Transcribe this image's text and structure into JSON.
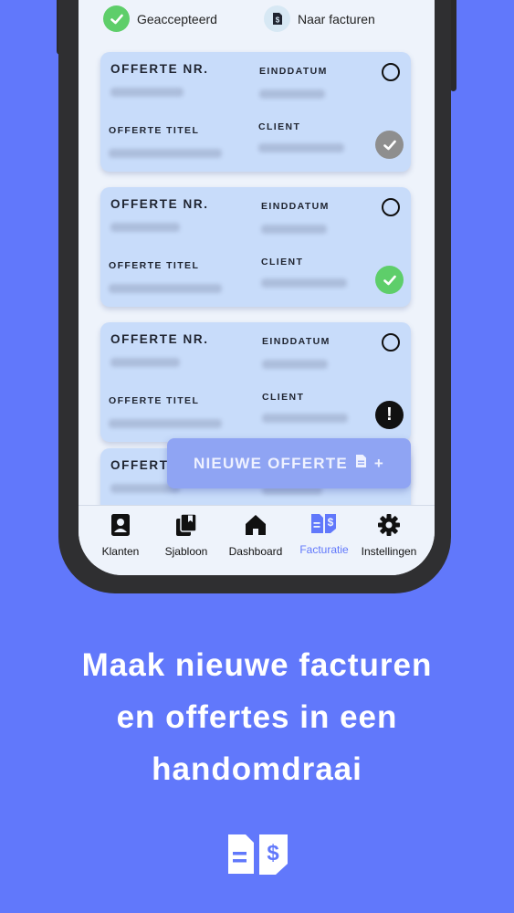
{
  "filters": {
    "accepted_label": "Geaccepteerd",
    "to_invoices_label": "Naar facturen"
  },
  "card_labels": {
    "quote_nr": "OFFERTE NR.",
    "end_date": "EINDDATUM",
    "quote_title": "OFFERTE TITEL",
    "client": "CLIENT"
  },
  "cards": [
    {
      "status": "accepted-grey"
    },
    {
      "status": "accepted-green"
    },
    {
      "status": "attention"
    }
  ],
  "partial_card_label": "OFFERT",
  "fab": {
    "label": "NIEUWE OFFERTE",
    "suffix": "+"
  },
  "nav": {
    "items": [
      {
        "label": "Klanten",
        "icon": "contacts-icon"
      },
      {
        "label": "Sjabloon",
        "icon": "templates-icon"
      },
      {
        "label": "Dashboard",
        "icon": "home-icon"
      },
      {
        "label": "Facturatie",
        "icon": "invoice-icon",
        "active": true
      },
      {
        "label": "Instellingen",
        "icon": "gear-icon"
      }
    ]
  },
  "headline": {
    "line1": "Maak nieuwe facturen",
    "line2": "en offertes in een",
    "line3": "handomdraai"
  },
  "colors": {
    "background": "#6178fb",
    "card": "#c8dcfa",
    "success": "#5ece6a",
    "fab": "#8fa4f3"
  }
}
